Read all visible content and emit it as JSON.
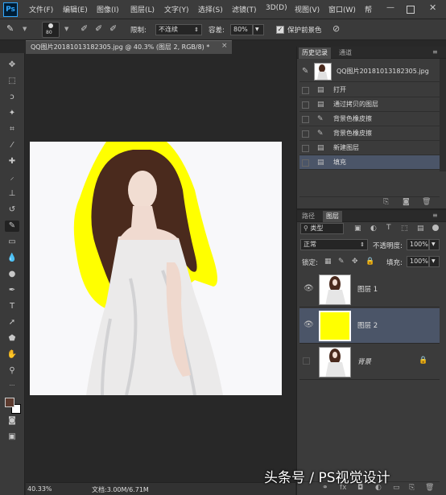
{
  "app": {
    "logo": "Ps"
  },
  "menu": [
    "文件(F)",
    "编辑(E)",
    "图像(I)",
    "图层(L)",
    "文字(Y)",
    "选择(S)",
    "滤镜(T)",
    "3D(D)",
    "视图(V)",
    "窗口(W)",
    "帮"
  ],
  "options": {
    "brush_size": "80",
    "limit_label": "限制:",
    "limit_value": "不连续",
    "tolerance_label": "容差:",
    "tolerance_value": "80%",
    "protect_label": "保护前景色"
  },
  "document": {
    "tab_title": "QQ图片20181013182305.jpg @ 40.3% (图层 2, RGB/8) *",
    "zoom": "40.33%",
    "doc_info": "文档:3.00M/6.71M"
  },
  "history": {
    "tabs": [
      "历史记录",
      "通道"
    ],
    "snapshot_name": "QQ图片20181013182305.jpg",
    "items": [
      "打开",
      "通过拷贝的图层",
      "背景色橡皮擦",
      "背景色橡皮擦",
      "新建图层",
      "填充"
    ]
  },
  "layers": {
    "tabs": [
      "路径",
      "图层"
    ],
    "filter_type": "类型",
    "blend_mode": "正常",
    "opacity_label": "不透明度:",
    "opacity_value": "100%",
    "lock_label": "锁定:",
    "fill_label": "填充:",
    "fill_value": "100%",
    "items": [
      {
        "name": "图层 1"
      },
      {
        "name": "图层 2"
      },
      {
        "name": "背景"
      }
    ]
  },
  "colors": {
    "fill_layer": "#ffff00",
    "foreground": "#5c3a2e",
    "background": "#ffffff",
    "selected_row": "#4b5568"
  },
  "watermark": "头条号 / PS视觉设计"
}
